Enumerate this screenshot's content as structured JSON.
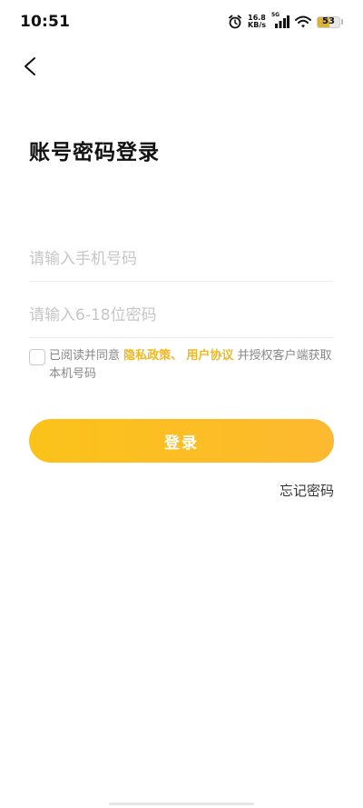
{
  "status_bar": {
    "time": "10:51",
    "net_speed_value": "16.8",
    "net_speed_unit": "KB/s",
    "network_type": "5G",
    "battery_level": "53",
    "battery_fraction": 0.53,
    "battery_color": "#d9b23a",
    "icons": [
      "alarm-icon",
      "signal-icon",
      "wifi-icon",
      "battery-icon"
    ]
  },
  "header": {
    "back_icon": "chevron-left-icon",
    "title": "账号密码登录"
  },
  "form": {
    "phone_placeholder": "请输入手机号码",
    "phone_value": "",
    "password_placeholder": "请输入6-18位密码",
    "password_value": ""
  },
  "agreement": {
    "checked": false,
    "prefix": "已阅读并同意",
    "privacy_link": "隐私政策",
    "separator": "、",
    "terms_link": "用户协议",
    "suffix": "并授权客户端获取本机号码"
  },
  "actions": {
    "login_label": "登录",
    "forgot_password_label": "忘记密码"
  },
  "colors": {
    "accent": "#fcbd26",
    "link": "#f2b722",
    "placeholder": "#c6c6c6"
  }
}
